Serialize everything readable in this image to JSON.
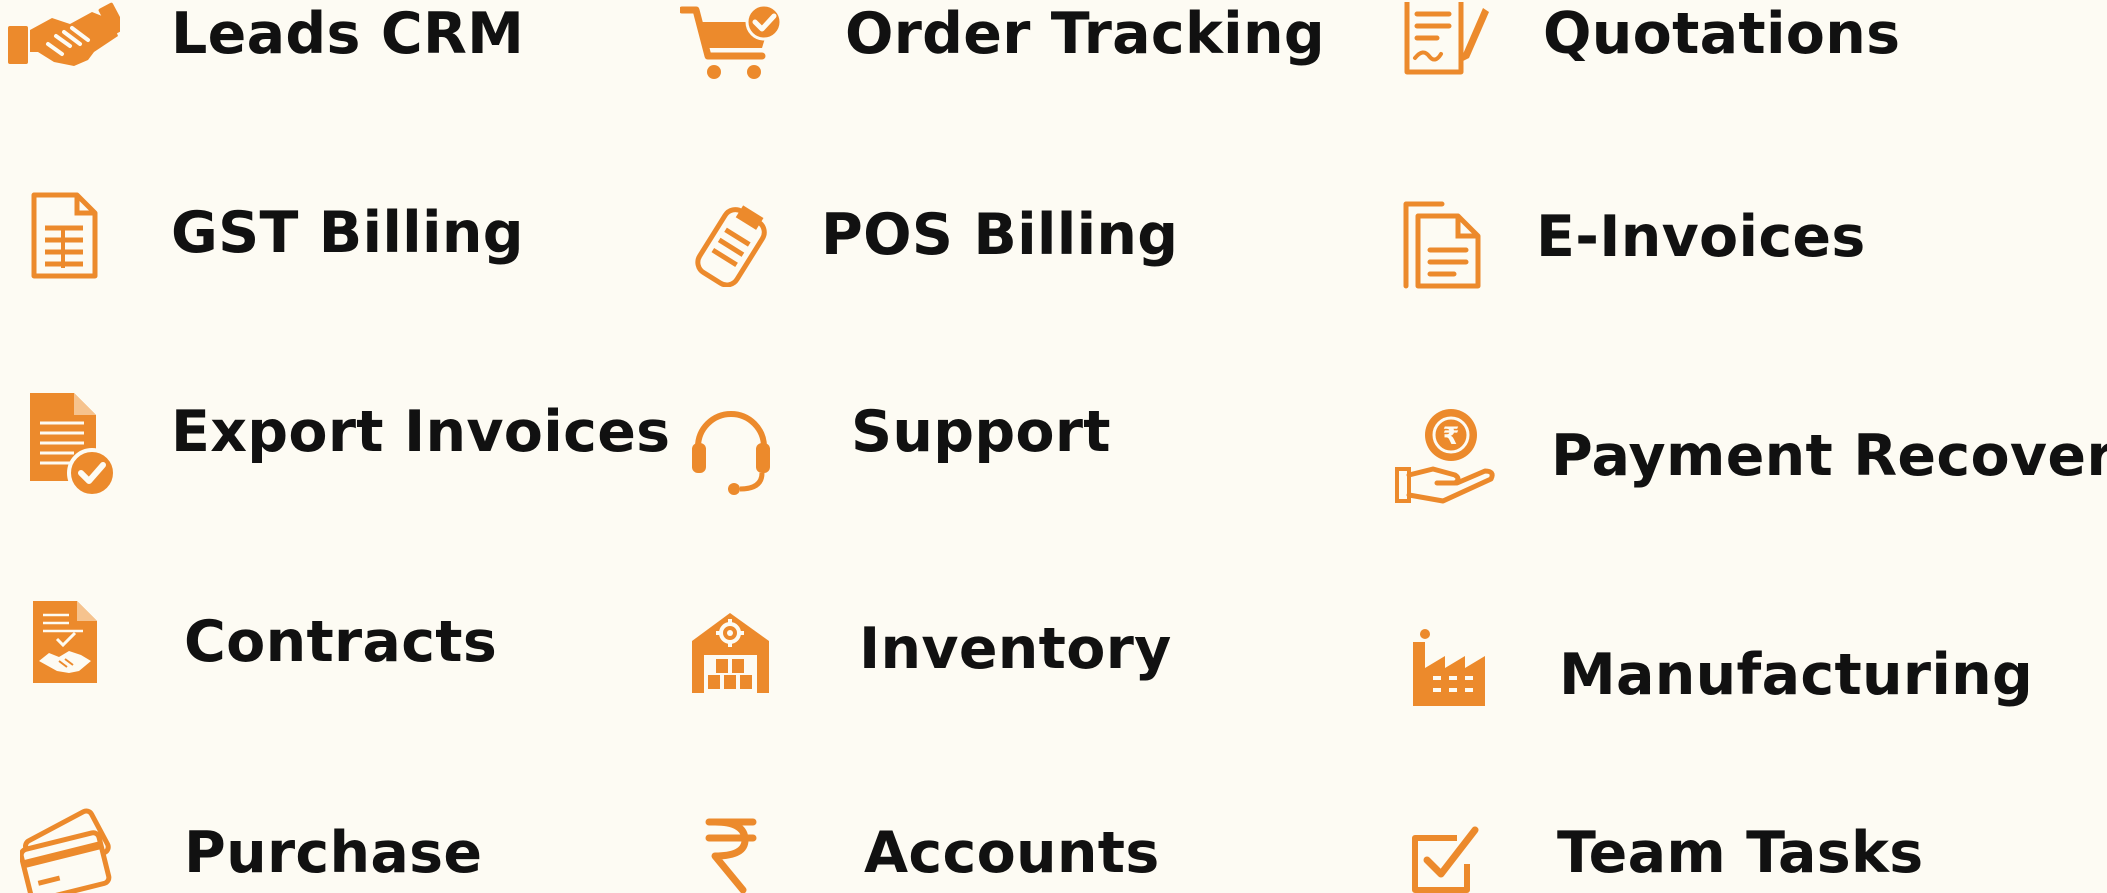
{
  "theme": {
    "background": "#fdfbf3",
    "accent": "#ec8a2c",
    "text": "#111111"
  },
  "features": [
    {
      "id": "leads-crm",
      "label": "Leads CRM",
      "icon": "handshake-icon"
    },
    {
      "id": "order-tracking",
      "label": "Order Tracking",
      "icon": "cart-check-icon"
    },
    {
      "id": "quotations",
      "label": "Quotations",
      "icon": "document-pen-icon"
    },
    {
      "id": "gst-billing",
      "label": "GST Billing",
      "icon": "bill-document-icon"
    },
    {
      "id": "pos-billing",
      "label": "POS Billing",
      "icon": "pos-machine-icon"
    },
    {
      "id": "e-invoices",
      "label": "E-Invoices",
      "icon": "stacked-documents-icon"
    },
    {
      "id": "export-invoices",
      "label": "Export Invoices",
      "icon": "invoice-check-icon"
    },
    {
      "id": "support",
      "label": "Support",
      "icon": "headset-icon"
    },
    {
      "id": "payment-recovery",
      "label": "Payment Recovery",
      "icon": "rupee-coin-hand-icon"
    },
    {
      "id": "contracts",
      "label": "Contracts",
      "icon": "contract-handshake-icon"
    },
    {
      "id": "inventory",
      "label": "Inventory",
      "icon": "warehouse-icon"
    },
    {
      "id": "manufacturing",
      "label": "Manufacturing",
      "icon": "factory-icon"
    },
    {
      "id": "purchase",
      "label": "Purchase",
      "icon": "credit-cards-icon"
    },
    {
      "id": "accounts",
      "label": "Accounts",
      "icon": "rupee-icon"
    },
    {
      "id": "team-tasks",
      "label": "Team Tasks",
      "icon": "checkbox-icon"
    }
  ]
}
